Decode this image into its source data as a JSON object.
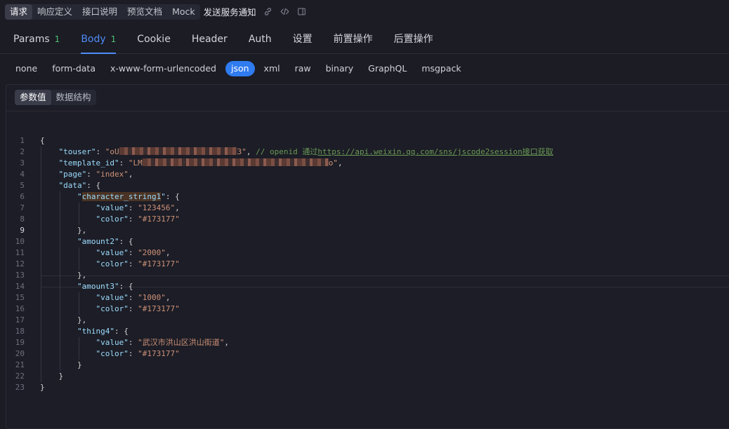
{
  "top_segments": [
    "请求",
    "响应定义",
    "接口说明",
    "预览文档",
    "Mock"
  ],
  "api_title": "发送服务通知",
  "toolbar_icons": [
    "link-icon",
    "code-icon",
    "panel-icon"
  ],
  "tabs": [
    {
      "label": "Params",
      "badge": "1"
    },
    {
      "label": "Body",
      "badge": "1"
    },
    {
      "label": "Cookie",
      "badge": ""
    },
    {
      "label": "Header",
      "badge": ""
    },
    {
      "label": "Auth",
      "badge": ""
    },
    {
      "label": "设置",
      "badge": ""
    },
    {
      "label": "前置操作",
      "badge": ""
    },
    {
      "label": "后置操作",
      "badge": ""
    }
  ],
  "active_tab": "Body",
  "body_types": [
    "none",
    "form-data",
    "x-www-form-urlencoded",
    "json",
    "xml",
    "raw",
    "binary",
    "GraphQL",
    "msgpack"
  ],
  "active_body_type": "json",
  "view_segments": [
    "参数值",
    "数据结构"
  ],
  "active_view": "参数值",
  "editor": {
    "current_line": 9,
    "lines": [
      {
        "n": "1"
      },
      {
        "n": "2"
      },
      {
        "n": "3"
      },
      {
        "n": "4"
      },
      {
        "n": "5"
      },
      {
        "n": "6"
      },
      {
        "n": "7"
      },
      {
        "n": "8"
      },
      {
        "n": "9"
      },
      {
        "n": "10"
      },
      {
        "n": "11"
      },
      {
        "n": "12"
      },
      {
        "n": "13"
      },
      {
        "n": "14"
      },
      {
        "n": "15"
      },
      {
        "n": "16"
      },
      {
        "n": "17"
      },
      {
        "n": "18"
      },
      {
        "n": "19"
      },
      {
        "n": "20"
      },
      {
        "n": "21"
      },
      {
        "n": "22"
      },
      {
        "n": "23"
      }
    ],
    "touser_prefix": "\"oU",
    "touser_suffix": "3\"",
    "comment_prefix": "// openid 通过",
    "comment_link": "https://api.weixin.qq.com/sns/jscode2session",
    "comment_suffix": "接口获取",
    "template_prefix": "\"LM",
    "template_suffix": "o\"",
    "page_value": "\"index\"",
    "keys": {
      "touser": "\"touser\"",
      "template_id": "\"template_id\"",
      "page": "\"page\"",
      "data": "\"data\"",
      "cs1_open": "\"",
      "cs1_name": "character_string1",
      "cs1_close": "\"",
      "amount2": "\"amount2\"",
      "amount3": "\"amount3\"",
      "thing4": "\"thing4\"",
      "value": "\"value\"",
      "color": "\"color\""
    },
    "values": {
      "cs1_value": "\"123456\"",
      "cs1_color": "\"#173177\"",
      "amount2_value": "\"2000\"",
      "amount2_color": "\"#173177\"",
      "amount3_value": "\"1000\"",
      "amount3_color": "\"#173177\"",
      "thing4_value": "\"武汉市洪山区洪山街道\"",
      "thing4_color": "\"#173177\""
    }
  },
  "colors": {
    "accent": "#4f8cf7",
    "active_pill": "#2f7bf0",
    "json_key": "#9cdcfe",
    "json_string": "#ce9178",
    "comment": "#6a9955"
  }
}
